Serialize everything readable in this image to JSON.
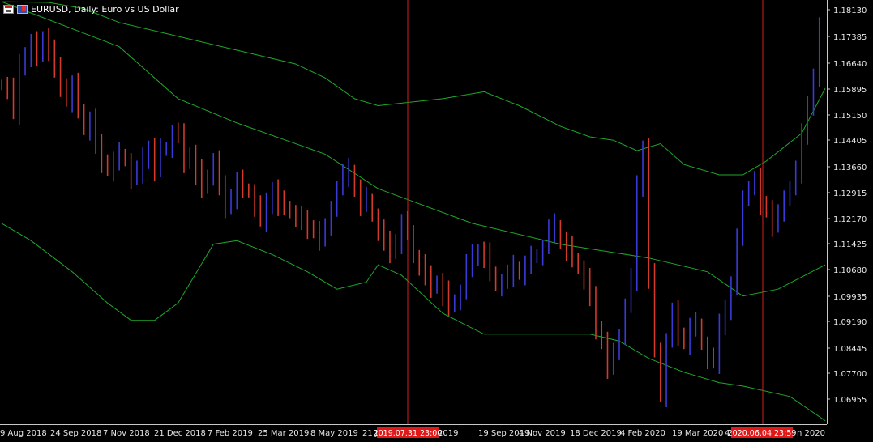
{
  "title": {
    "symbol_text": "EURUSD, Daily:  Euro vs US Dollar",
    "icons": [
      "chart-window-icon",
      "currency-flag-icon"
    ]
  },
  "colors": {
    "background": "#000000",
    "bull_bar": "#3a3ad6",
    "bear_bar": "#d23a2a",
    "bands": "#1fa82a",
    "axis": "#c8c8c8",
    "vertical_line": "#d42020",
    "time_marker_bg": "#e01818"
  },
  "chart_data": {
    "type": "bar",
    "symbol": "EURUSD",
    "timeframe": "Daily",
    "ylim": [
      1.062,
      1.1845
    ],
    "y_ticks": [
      "1.18130",
      "1.17385",
      "1.16640",
      "1.15895",
      "1.15150",
      "1.14405",
      "1.13660",
      "1.12915",
      "1.12170",
      "1.11425",
      "1.10680",
      "1.09935",
      "1.09190",
      "1.08445",
      "1.07700",
      "1.06955"
    ],
    "x_labels": [
      "9 Aug 2018",
      "24 Sep 2018",
      "7 Nov 2018",
      "21 Dec 2018",
      "7 Feb 2019",
      "25 Mar 2019",
      "8 May 2019",
      "21 J",
      "2019",
      "19 Sep 2019",
      "4 Nov 2019",
      "18 Dec 2019",
      "4 Feb 2020",
      "19 Mar 2020",
      "4",
      "n 2020"
    ],
    "time_markers": [
      "2019.07.31 23:00",
      "2020.06.04 23:59"
    ],
    "vertical_lines": [
      "2019.07.31 23:00",
      "2020.06.04 23:59"
    ],
    "series": [
      {
        "type": "bollinger-upper",
        "points": [
          [
            0,
            1.184
          ],
          [
            8,
            1.1838
          ],
          [
            14,
            1.182
          ],
          [
            20,
            1.178
          ],
          [
            30,
            1.174
          ],
          [
            40,
            1.17
          ],
          [
            50,
            1.166
          ],
          [
            55,
            1.162
          ],
          [
            60,
            1.156
          ],
          [
            64,
            1.154
          ],
          [
            75,
            1.156
          ],
          [
            82,
            1.158
          ],
          [
            88,
            1.154
          ],
          [
            95,
            1.148
          ],
          [
            100,
            1.145
          ],
          [
            104,
            1.144
          ],
          [
            108,
            1.141
          ],
          [
            112,
            1.143
          ],
          [
            116,
            1.137
          ],
          [
            122,
            1.134
          ],
          [
            126,
            1.134
          ],
          [
            130,
            1.138
          ],
          [
            136,
            1.146
          ],
          [
            140,
            1.159
          ]
        ]
      },
      {
        "type": "bollinger-middle",
        "points": [
          [
            0,
            1.184
          ],
          [
            20,
            1.171
          ],
          [
            30,
            1.156
          ],
          [
            40,
            1.149
          ],
          [
            55,
            1.14
          ],
          [
            64,
            1.13
          ],
          [
            80,
            1.12
          ],
          [
            95,
            1.114
          ],
          [
            110,
            1.11
          ],
          [
            120,
            1.106
          ],
          [
            126,
            1.099
          ],
          [
            132,
            1.101
          ],
          [
            140,
            1.108
          ]
        ]
      },
      {
        "type": "bollinger-lower",
        "points": [
          [
            0,
            1.12
          ],
          [
            5,
            1.115
          ],
          [
            12,
            1.106
          ],
          [
            18,
            1.097
          ],
          [
            22,
            1.092
          ],
          [
            26,
            1.092
          ],
          [
            30,
            1.097
          ],
          [
            36,
            1.114
          ],
          [
            40,
            1.115
          ],
          [
            46,
            1.111
          ],
          [
            52,
            1.106
          ],
          [
            57,
            1.101
          ],
          [
            62,
            1.103
          ],
          [
            64,
            1.108
          ],
          [
            68,
            1.105
          ],
          [
            75,
            1.094
          ],
          [
            82,
            1.088
          ],
          [
            90,
            1.088
          ],
          [
            100,
            1.088
          ],
          [
            105,
            1.086
          ],
          [
            110,
            1.081
          ],
          [
            116,
            1.077
          ],
          [
            122,
            1.074
          ],
          [
            126,
            1.073
          ],
          [
            134,
            1.07
          ],
          [
            140,
            1.063
          ]
        ]
      },
      {
        "type": "ohlc-close",
        "values": [
          1.16,
          1.159,
          1.152,
          1.165,
          1.169,
          1.172,
          1.168,
          1.174,
          1.17,
          1.164,
          1.16,
          1.156,
          1.16,
          1.153,
          1.147,
          1.15,
          1.142,
          1.138,
          1.136,
          1.138,
          1.14,
          1.138,
          1.133,
          1.135,
          1.138,
          1.142,
          1.136,
          1.141,
          1.142,
          1.146,
          1.145,
          1.138,
          1.14,
          1.135,
          1.13,
          1.134,
          1.138,
          1.13,
          1.125,
          1.128,
          1.132,
          1.13,
          1.129,
          1.125,
          1.121,
          1.125,
          1.13,
          1.126,
          1.125,
          1.123,
          1.122,
          1.12,
          1.119,
          1.118,
          1.116,
          1.118,
          1.125,
          1.13,
          1.134,
          1.135,
          1.13,
          1.126,
          1.127,
          1.122,
          1.118,
          1.114,
          1.112,
          1.115,
          1.12,
          1.118,
          1.11,
          1.108,
          1.104,
          1.102,
          1.103,
          1.1,
          1.096,
          1.098,
          1.1,
          1.108,
          1.11,
          1.112,
          1.111,
          1.106,
          1.102,
          1.103,
          1.105,
          1.107,
          1.106,
          1.108,
          1.11,
          1.111,
          1.113,
          1.118,
          1.119,
          1.115,
          1.113,
          1.11,
          1.107,
          1.104,
          1.098,
          1.09,
          1.086,
          1.079,
          1.082,
          1.088,
          1.096,
          1.104,
          1.13,
          1.142,
          1.105,
          1.084,
          1.07,
          1.086,
          1.094,
          1.088,
          1.086,
          1.09,
          1.091,
          1.085,
          1.081,
          1.08,
          1.09,
          1.096,
          1.102,
          1.115,
          1.128,
          1.13,
          1.132,
          1.126,
          1.124,
          1.12,
          1.122,
          1.128,
          1.13,
          1.135,
          1.145,
          1.155,
          1.162,
          1.176
        ]
      }
    ]
  }
}
